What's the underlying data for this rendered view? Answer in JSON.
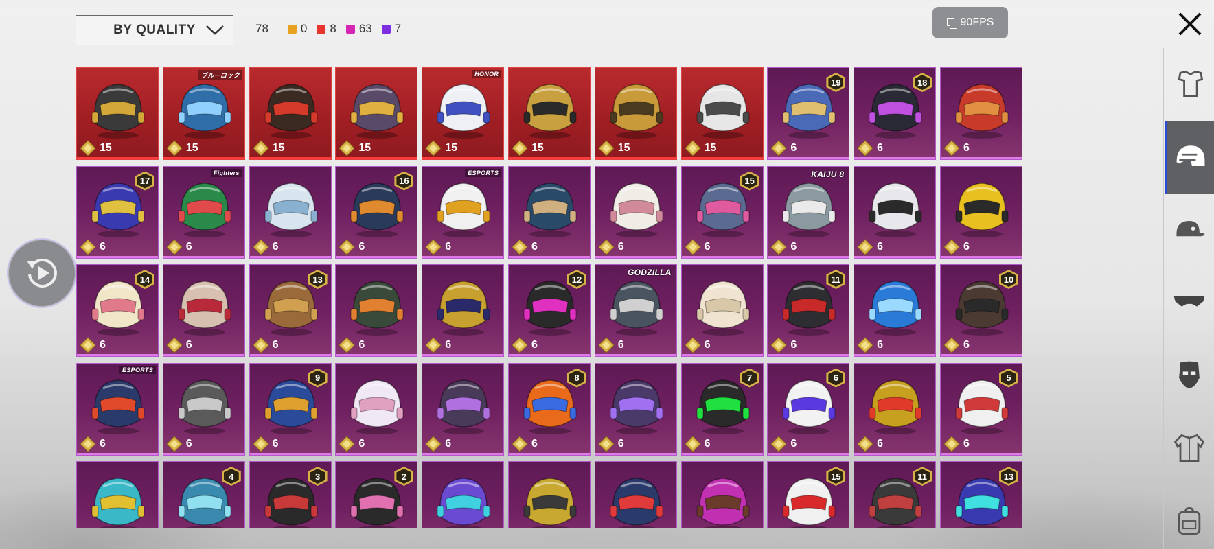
{
  "sort": {
    "label": "BY QUALITY"
  },
  "counts": {
    "total": "78",
    "items": [
      {
        "value": "0",
        "color": "#e8a221"
      },
      {
        "value": "8",
        "color": "#e8332e"
      },
      {
        "value": "63",
        "color": "#d426b3"
      },
      {
        "value": "7",
        "color": "#7c2ee0"
      }
    ]
  },
  "fps": {
    "label": "90FPS"
  },
  "tiles": [
    {
      "rarity": "red",
      "points": "15",
      "icon": "helmet-icon",
      "color": "#3a3a3a",
      "accent": "#d4a838"
    },
    {
      "rarity": "red",
      "points": "15",
      "icon": "helmet-icon",
      "color": "#2f6ea8",
      "accent": "#8fd0ff",
      "tag": "ブルーロック"
    },
    {
      "rarity": "red",
      "points": "15",
      "icon": "helmet-icon",
      "color": "#3b2a22",
      "accent": "#d63a2a"
    },
    {
      "rarity": "red",
      "points": "15",
      "icon": "helmet-icon",
      "color": "#5a4a6a",
      "accent": "#e0b040"
    },
    {
      "rarity": "red",
      "points": "15",
      "icon": "helmet-icon",
      "color": "#eef0f6",
      "accent": "#4050c0",
      "tag": "HONOR"
    },
    {
      "rarity": "red",
      "points": "15",
      "icon": "helmet-icon",
      "color": "#c8a040",
      "accent": "#2a2a2a"
    },
    {
      "rarity": "red",
      "points": "15",
      "icon": "helmet-icon",
      "color": "#c89a3a",
      "accent": "#4a3a20"
    },
    {
      "rarity": "red",
      "points": "15",
      "icon": "helmet-icon",
      "color": "#e6e6e6",
      "accent": "#4a4a4a"
    },
    {
      "rarity": "purple",
      "points": "6",
      "icon": "helmet-icon",
      "color": "#4a6ab8",
      "accent": "#e0c070",
      "level": "19"
    },
    {
      "rarity": "purple",
      "points": "6",
      "icon": "helmet-icon",
      "color": "#2a2a36",
      "accent": "#c050e0",
      "level": "18"
    },
    {
      "rarity": "purple",
      "points": "6",
      "icon": "helmet-icon",
      "color": "#c83a2a",
      "accent": "#e09040"
    },
    {
      "rarity": "purple",
      "points": "6",
      "icon": "helmet-icon",
      "color": "#3a3ab0",
      "accent": "#e0c040",
      "level": "17"
    },
    {
      "rarity": "purple",
      "points": "6",
      "icon": "helmet-icon",
      "color": "#2a8a4a",
      "accent": "#e04a4a",
      "tag": "Fighters"
    },
    {
      "rarity": "purple",
      "points": "6",
      "icon": "helmet-icon",
      "color": "#d8e4ee",
      "accent": "#8ab0d0"
    },
    {
      "rarity": "purple",
      "points": "6",
      "icon": "helmet-icon",
      "color": "#2a3a5a",
      "accent": "#e08a30",
      "level": "16"
    },
    {
      "rarity": "purple",
      "points": "6",
      "icon": "helmet-icon",
      "color": "#f0f0f0",
      "accent": "#e0a020",
      "tag": "ESPORTS"
    },
    {
      "rarity": "purple",
      "points": "6",
      "icon": "helmet-icon",
      "color": "#2a4a6a",
      "accent": "#d0b080"
    },
    {
      "rarity": "purple",
      "points": "6",
      "icon": "helmet-icon",
      "color": "#f0ece6",
      "accent": "#d08a9a"
    },
    {
      "rarity": "purple",
      "points": "6",
      "icon": "helmet-icon",
      "color": "#5a6a90",
      "accent": "#e05aa0",
      "level": "15"
    },
    {
      "rarity": "purple",
      "points": "6",
      "icon": "helmet-icon",
      "color": "#8a9aa0",
      "accent": "#eaeaea",
      "tag": "KAIJU 8"
    },
    {
      "rarity": "purple",
      "points": "6",
      "icon": "helmet-icon",
      "color": "#e8e8ec",
      "accent": "#2a2a2a"
    },
    {
      "rarity": "purple",
      "points": "6",
      "icon": "helmet-icon",
      "color": "#e8c020",
      "accent": "#2a2a2a"
    },
    {
      "rarity": "purple",
      "points": "6",
      "icon": "helmet-icon",
      "color": "#f2e6c8",
      "accent": "#e07a8a",
      "level": "14"
    },
    {
      "rarity": "purple",
      "points": "6",
      "icon": "helmet-icon",
      "color": "#d8c0b0",
      "accent": "#b82a3a"
    },
    {
      "rarity": "purple",
      "points": "6",
      "icon": "helmet-icon",
      "color": "#9a6a3a",
      "accent": "#d0a050",
      "level": "13"
    },
    {
      "rarity": "purple",
      "points": "6",
      "icon": "helmet-icon",
      "color": "#3a4a3a",
      "accent": "#e08030"
    },
    {
      "rarity": "purple",
      "points": "6",
      "icon": "helmet-icon",
      "color": "#c8a030",
      "accent": "#2a2a6a"
    },
    {
      "rarity": "purple",
      "points": "6",
      "icon": "helmet-icon",
      "color": "#2a2a2a",
      "accent": "#e030c0",
      "level": "12"
    },
    {
      "rarity": "purple",
      "points": "6",
      "icon": "helmet-icon",
      "color": "#4a5460",
      "accent": "#d0d0d0",
      "tag": "GODZILLA"
    },
    {
      "rarity": "purple",
      "points": "6",
      "icon": "helmet-icon",
      "color": "#f0e4d0",
      "accent": "#d8c8a8"
    },
    {
      "rarity": "purple",
      "points": "6",
      "icon": "helmet-icon",
      "color": "#2e2e32",
      "accent": "#c82a2a",
      "level": "11"
    },
    {
      "rarity": "purple",
      "points": "6",
      "icon": "helmet-icon",
      "color": "#2a7ad8",
      "accent": "#9adaff"
    },
    {
      "rarity": "purple",
      "points": "6",
      "icon": "helmet-icon",
      "color": "#4a3a32",
      "accent": "#2a2a2a",
      "level": "10"
    },
    {
      "rarity": "purple",
      "points": "6",
      "icon": "helmet-icon",
      "color": "#2a3a6a",
      "accent": "#e04a2a",
      "tag": "ESPORTS"
    },
    {
      "rarity": "purple",
      "points": "6",
      "icon": "helmet-icon",
      "color": "#5a5a5a",
      "accent": "#c8c8c8"
    },
    {
      "rarity": "purple",
      "points": "6",
      "icon": "helmet-icon",
      "color": "#2a4a9a",
      "accent": "#e0a030",
      "level": "9"
    },
    {
      "rarity": "purple",
      "points": "6",
      "icon": "helmet-icon",
      "color": "#f0e8f4",
      "accent": "#e0a0c0"
    },
    {
      "rarity": "purple",
      "points": "6",
      "icon": "helmet-icon",
      "color": "#4a3a5a",
      "accent": "#b070e0"
    },
    {
      "rarity": "purple",
      "points": "6",
      "icon": "helmet-icon",
      "color": "#e86a1a",
      "accent": "#3a6ae0",
      "level": "8"
    },
    {
      "rarity": "purple",
      "points": "6",
      "icon": "helmet-icon",
      "color": "#4a3a6a",
      "accent": "#a070f0"
    },
    {
      "rarity": "purple",
      "points": "6",
      "icon": "helmet-icon",
      "color": "#2a2a2a",
      "accent": "#20e040",
      "level": "7"
    },
    {
      "rarity": "purple",
      "points": "6",
      "icon": "helmet-icon",
      "color": "#f2f2f2",
      "accent": "#5a3ae0",
      "level": "6"
    },
    {
      "rarity": "purple",
      "points": "6",
      "icon": "helmet-icon",
      "color": "#c8a020",
      "accent": "#e03a2a"
    },
    {
      "rarity": "purple",
      "points": "6",
      "icon": "helmet-icon",
      "color": "#f0f0f0",
      "accent": "#d03a3a",
      "level": "5"
    },
    {
      "rarity": "purple",
      "points": "",
      "icon": "helmet-icon",
      "color": "#3ab8c8",
      "accent": "#e0c030"
    },
    {
      "rarity": "purple",
      "points": "",
      "icon": "helmet-icon",
      "color": "#3a8ab0",
      "accent": "#90e0f0",
      "level": "4"
    },
    {
      "rarity": "purple",
      "points": "",
      "icon": "helmet-icon",
      "color": "#2a2a2a",
      "accent": "#c83a3a",
      "level": "3"
    },
    {
      "rarity": "purple",
      "points": "",
      "icon": "helmet-icon",
      "color": "#2a2a2a",
      "accent": "#e070b0",
      "level": "2"
    },
    {
      "rarity": "purple",
      "points": "",
      "icon": "helmet-icon",
      "color": "#6a4ad0",
      "accent": "#40d0e0"
    },
    {
      "rarity": "purple",
      "points": "",
      "icon": "helmet-icon",
      "color": "#c8a830",
      "accent": "#3a3a3a"
    },
    {
      "rarity": "purple",
      "points": "",
      "icon": "helmet-icon",
      "color": "#2a3a6a",
      "accent": "#e03a3a"
    },
    {
      "rarity": "purple",
      "points": "",
      "icon": "helmet-icon",
      "color": "#c030b0",
      "accent": "#6a3a2a"
    },
    {
      "rarity": "purple",
      "points": "",
      "icon": "helmet-icon",
      "color": "#f0f0f0",
      "accent": "#d82a2a",
      "level": "15"
    },
    {
      "rarity": "purple",
      "points": "",
      "icon": "helmet-icon",
      "color": "#3a3a3a",
      "accent": "#c04040",
      "level": "11"
    },
    {
      "rarity": "purple",
      "points": "",
      "icon": "helmet-icon",
      "color": "#3a3ab0",
      "accent": "#40e0e0",
      "level": "13"
    }
  ],
  "side_tabs": [
    {
      "name": "side-tab-outfit",
      "icon": "outfit-icon",
      "active": false
    },
    {
      "name": "side-tab-helmet",
      "icon": "helmet-icon",
      "active": true
    },
    {
      "name": "side-tab-hat",
      "icon": "cap-icon",
      "active": false
    },
    {
      "name": "side-tab-eyewear",
      "icon": "sunglasses-icon",
      "active": false
    },
    {
      "name": "side-tab-mask",
      "icon": "mask-icon",
      "active": false
    },
    {
      "name": "side-tab-jacket",
      "icon": "jacket-icon",
      "active": false
    },
    {
      "name": "side-tab-backpack",
      "icon": "backpack-icon",
      "active": false
    }
  ]
}
